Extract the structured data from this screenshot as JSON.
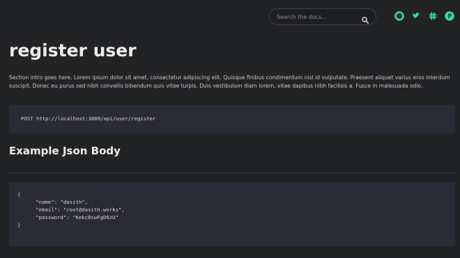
{
  "header": {
    "search": {
      "placeholder": "Search the docs..."
    },
    "social": [
      {
        "icon": "github-icon",
        "color": "#31d89c"
      },
      {
        "icon": "twitter-icon",
        "color": "#31d89c"
      },
      {
        "icon": "slack-icon",
        "color": "#31d89c"
      },
      {
        "icon": "product-hunt-icon",
        "color": "#31d89c"
      }
    ]
  },
  "main": {
    "title": "register user",
    "intro": "Section intro goes here. Lorem ipsum dolor sit amet, consectetur adipiscing elit. Quisque finibus condimentum nisl id vulputate. Praesent aliquet varius eros interdum suscipit. Donec eu purus sed nibh convallis bibendum quis vitae turpis. Duis vestibulum diam lorem, vitae dapibus nibh facilisis a. Fusce in malesuada odio.",
    "endpoint": "POST http://localhost:3000/api/user/register",
    "example_heading": "Example Json Body",
    "example_json": "{\n      \"name\": \"dasith\",\n      \"email\": \"root@dasith.works\",\n      \"password\": \"Kekc8swFgD6zU\"\n}"
  },
  "colors": {
    "background": "#222325",
    "code_background": "#2a2b35",
    "accent": "#31d89c"
  }
}
